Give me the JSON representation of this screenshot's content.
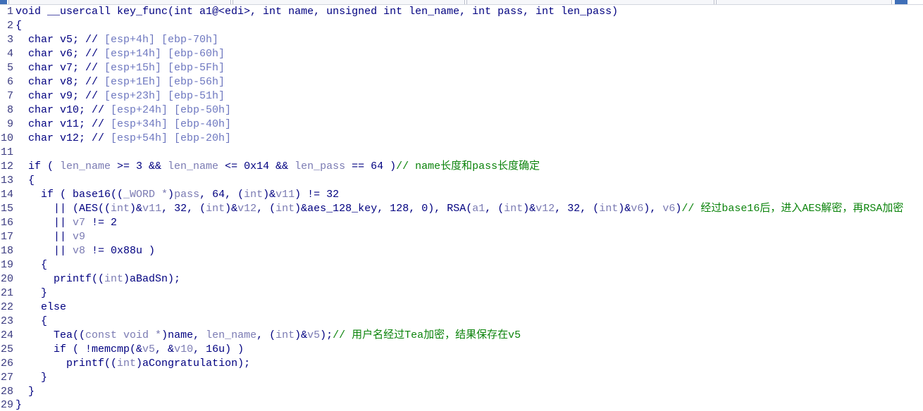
{
  "colors": {
    "background": "#ffffff",
    "code": "#000080",
    "variable": "#7b7bb3",
    "cast_type": "#7b7bb3",
    "comment": "#0c840c",
    "auto_comment": "#6e78c0",
    "line_number": "#3a3a80"
  },
  "lines": [
    {
      "num": "1",
      "tokens": [
        {
          "t": "void __usercall key_func(int a1@<edi>, int name, unsigned int len_name, int pass, int len_pass)",
          "c": "code"
        }
      ]
    },
    {
      "num": "2",
      "tokens": [
        {
          "t": "{",
          "c": "code"
        }
      ]
    },
    {
      "num": "3",
      "tokens": [
        {
          "t": "  char v5; //",
          "c": "code"
        },
        {
          "t": " [esp+4h] [ebp-70h]",
          "c": "auto_comment"
        }
      ]
    },
    {
      "num": "4",
      "tokens": [
        {
          "t": "  char v6; //",
          "c": "code"
        },
        {
          "t": " [esp+14h] [ebp-60h]",
          "c": "auto_comment"
        }
      ]
    },
    {
      "num": "5",
      "tokens": [
        {
          "t": "  char v7; //",
          "c": "code"
        },
        {
          "t": " [esp+15h] [ebp-5Fh]",
          "c": "auto_comment"
        }
      ]
    },
    {
      "num": "6",
      "tokens": [
        {
          "t": "  char v8; //",
          "c": "code"
        },
        {
          "t": " [esp+1Eh] [ebp-56h]",
          "c": "auto_comment"
        }
      ]
    },
    {
      "num": "7",
      "tokens": [
        {
          "t": "  char v9; //",
          "c": "code"
        },
        {
          "t": " [esp+23h] [ebp-51h]",
          "c": "auto_comment"
        }
      ]
    },
    {
      "num": "8",
      "tokens": [
        {
          "t": "  char v10; //",
          "c": "code"
        },
        {
          "t": " [esp+24h] [ebp-50h]",
          "c": "auto_comment"
        }
      ]
    },
    {
      "num": "9",
      "tokens": [
        {
          "t": "  char v11; //",
          "c": "code"
        },
        {
          "t": " [esp+34h] [ebp-40h]",
          "c": "auto_comment"
        }
      ]
    },
    {
      "num": "10",
      "tokens": [
        {
          "t": "  char v12; //",
          "c": "code"
        },
        {
          "t": " [esp+54h] [ebp-20h]",
          "c": "auto_comment"
        }
      ]
    },
    {
      "num": "11",
      "tokens": []
    },
    {
      "num": "12",
      "tokens": [
        {
          "t": "  if ( ",
          "c": "code"
        },
        {
          "t": "len_name",
          "c": "variable"
        },
        {
          "t": " >= 3 && ",
          "c": "code"
        },
        {
          "t": "len_name",
          "c": "variable"
        },
        {
          "t": " <= 0x14 && ",
          "c": "code"
        },
        {
          "t": "len_pass",
          "c": "variable"
        },
        {
          "t": " == 64 )",
          "c": "code"
        },
        {
          "t": "// name长度和pass长度确定",
          "c": "comment"
        }
      ]
    },
    {
      "num": "13",
      "tokens": [
        {
          "t": "  {",
          "c": "code"
        }
      ]
    },
    {
      "num": "14",
      "tokens": [
        {
          "t": "    if ( base16((",
          "c": "code"
        },
        {
          "t": "_WORD *",
          "c": "cast_type"
        },
        {
          "t": ")",
          "c": "code"
        },
        {
          "t": "pass",
          "c": "variable"
        },
        {
          "t": ", 64, (",
          "c": "code"
        },
        {
          "t": "int",
          "c": "cast_type"
        },
        {
          "t": ")&",
          "c": "code"
        },
        {
          "t": "v11",
          "c": "variable"
        },
        {
          "t": ") != 32",
          "c": "code"
        }
      ]
    },
    {
      "num": "15",
      "tokens": [
        {
          "t": "      || (AES((",
          "c": "code"
        },
        {
          "t": "int",
          "c": "cast_type"
        },
        {
          "t": ")&",
          "c": "code"
        },
        {
          "t": "v11",
          "c": "variable"
        },
        {
          "t": ", 32, (",
          "c": "code"
        },
        {
          "t": "int",
          "c": "cast_type"
        },
        {
          "t": ")&",
          "c": "code"
        },
        {
          "t": "v12",
          "c": "variable"
        },
        {
          "t": ", (",
          "c": "code"
        },
        {
          "t": "int",
          "c": "cast_type"
        },
        {
          "t": ")&aes_128_key, 128, 0), RSA(",
          "c": "code"
        },
        {
          "t": "a1",
          "c": "variable"
        },
        {
          "t": ", (",
          "c": "code"
        },
        {
          "t": "int",
          "c": "cast_type"
        },
        {
          "t": ")&",
          "c": "code"
        },
        {
          "t": "v12",
          "c": "variable"
        },
        {
          "t": ", 32, (",
          "c": "code"
        },
        {
          "t": "int",
          "c": "cast_type"
        },
        {
          "t": ")&",
          "c": "code"
        },
        {
          "t": "v6",
          "c": "variable"
        },
        {
          "t": "), ",
          "c": "code"
        },
        {
          "t": "v6",
          "c": "variable"
        },
        {
          "t": ")",
          "c": "code"
        },
        {
          "t": "// 经过base16后，进入AES解密，再RSA加密",
          "c": "comment"
        }
      ]
    },
    {
      "num": "16",
      "tokens": [
        {
          "t": "      || ",
          "c": "code"
        },
        {
          "t": "v7",
          "c": "variable"
        },
        {
          "t": " != 2",
          "c": "code"
        }
      ]
    },
    {
      "num": "17",
      "tokens": [
        {
          "t": "      || ",
          "c": "code"
        },
        {
          "t": "v9",
          "c": "variable"
        }
      ]
    },
    {
      "num": "18",
      "tokens": [
        {
          "t": "      || ",
          "c": "code"
        },
        {
          "t": "v8",
          "c": "variable"
        },
        {
          "t": " != 0x88u )",
          "c": "code"
        }
      ]
    },
    {
      "num": "19",
      "tokens": [
        {
          "t": "    {",
          "c": "code"
        }
      ]
    },
    {
      "num": "20",
      "tokens": [
        {
          "t": "      printf((",
          "c": "code"
        },
        {
          "t": "int",
          "c": "cast_type"
        },
        {
          "t": ")aBadSn);",
          "c": "code"
        }
      ]
    },
    {
      "num": "21",
      "tokens": [
        {
          "t": "    }",
          "c": "code"
        }
      ]
    },
    {
      "num": "22",
      "tokens": [
        {
          "t": "    else",
          "c": "code"
        }
      ]
    },
    {
      "num": "23",
      "tokens": [
        {
          "t": "    {",
          "c": "code"
        }
      ]
    },
    {
      "num": "24",
      "tokens": [
        {
          "t": "      Tea((",
          "c": "code"
        },
        {
          "t": "const void *",
          "c": "cast_type"
        },
        {
          "t": ")name, ",
          "c": "code"
        },
        {
          "t": "len_name",
          "c": "variable"
        },
        {
          "t": ", (",
          "c": "code"
        },
        {
          "t": "int",
          "c": "cast_type"
        },
        {
          "t": ")&",
          "c": "code"
        },
        {
          "t": "v5",
          "c": "variable"
        },
        {
          "t": ");",
          "c": "code"
        },
        {
          "t": "// 用户名经过Tea加密，结果保存在v5",
          "c": "comment"
        }
      ]
    },
    {
      "num": "25",
      "tokens": [
        {
          "t": "      if ( !memcmp(&",
          "c": "code"
        },
        {
          "t": "v5",
          "c": "variable"
        },
        {
          "t": ", &",
          "c": "code"
        },
        {
          "t": "v10",
          "c": "variable"
        },
        {
          "t": ", 16u) )",
          "c": "code"
        }
      ]
    },
    {
      "num": "26",
      "tokens": [
        {
          "t": "        printf((",
          "c": "code"
        },
        {
          "t": "int",
          "c": "cast_type"
        },
        {
          "t": ")aCongratulation);",
          "c": "code"
        }
      ]
    },
    {
      "num": "27",
      "tokens": [
        {
          "t": "    }",
          "c": "code"
        }
      ]
    },
    {
      "num": "28",
      "tokens": [
        {
          "t": "  }",
          "c": "code"
        }
      ]
    },
    {
      "num": "29",
      "tokens": [
        {
          "t": "}",
          "c": "code"
        }
      ]
    }
  ]
}
